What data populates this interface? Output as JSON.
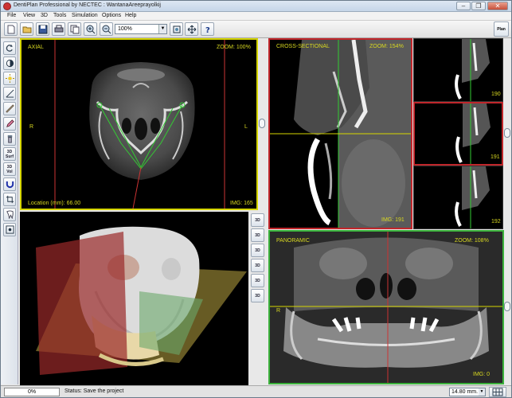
{
  "app": {
    "title": "DentiPlan Professional   by NECTEC : WantanaAreeprayolkij"
  },
  "window_controls": {
    "minimize": "–",
    "restore": "❐",
    "close": "✕"
  },
  "menu": [
    "File",
    "View",
    "3D",
    "Tools",
    "Simulation",
    "Options",
    "Help"
  ],
  "toolbar": {
    "zoom_value": "100%",
    "buttons": [
      "new-icon",
      "open-icon",
      "save-icon",
      "print-icon",
      "copy-icon",
      "zoom-in-icon",
      "zoom-out-icon",
      "zoom-fit-icon",
      "pan-icon",
      "help-icon"
    ],
    "plan_label": "Plan"
  },
  "left_tools": {
    "surf_label": "3D Surf",
    "vol_label": "3D Vol"
  },
  "axial": {
    "title": "AXIAL",
    "zoom": "ZOOM: 100%",
    "location": "Location (mm): 66.00",
    "img": "IMG: 165",
    "right_marker": "R",
    "left_marker": "L"
  },
  "cross": {
    "title": "CROSS-SECTIONAL",
    "zoom": "ZOOM: 154%",
    "img": "IMG: 191"
  },
  "thumbnails": [
    {
      "num": "190",
      "selected": false
    },
    {
      "num": "191",
      "selected": true
    },
    {
      "num": "192",
      "selected": false
    }
  ],
  "view3d_buttons": [
    "3D",
    "3D",
    "3D",
    "3D",
    "3D",
    "3D"
  ],
  "panoramic": {
    "title": "PANORAMIC",
    "zoom": "ZOOM: 108%",
    "img": "IMG: 0",
    "right_marker": "R"
  },
  "status": {
    "progress": "0%",
    "progress_value": 0,
    "message": "Status: Save the project",
    "unit": "14.80 mm."
  },
  "colors": {
    "axial_border": "#d6d600",
    "cross_border": "#c0262b",
    "pano_border": "#3bb13b",
    "overlay_text": "#d8d820"
  }
}
